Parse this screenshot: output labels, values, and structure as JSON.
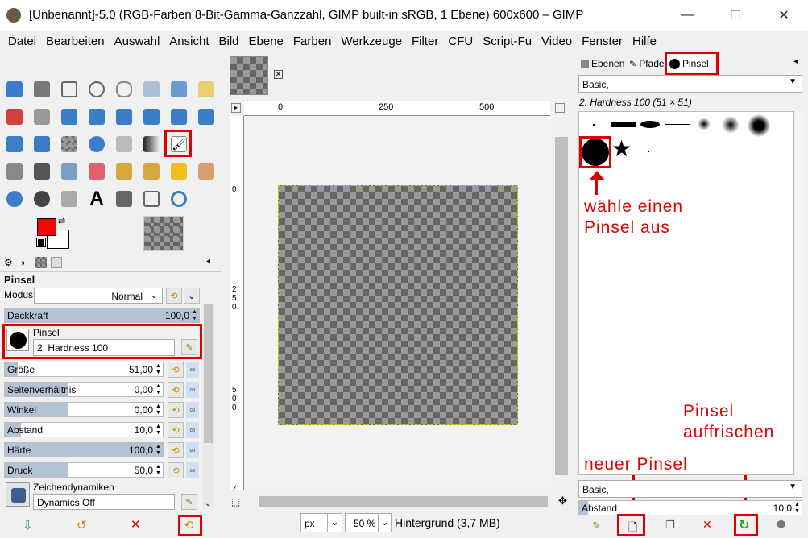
{
  "window": {
    "title": "[Unbenannt]-5.0 (RGB-Farben 8-Bit-Gamma-Ganzzahl, GIMP built-in sRGB, 1 Ebene) 600x600 – GIMP",
    "minimize": "—",
    "maximize": "☐",
    "close": "✕"
  },
  "menu": [
    "Datei",
    "Bearbeiten",
    "Auswahl",
    "Ansicht",
    "Bild",
    "Ebene",
    "Farben",
    "Werkzeuge",
    "Filter",
    "CFU",
    "Script-Fu",
    "Video",
    "Fenster",
    "Hilfe"
  ],
  "tool_options": {
    "title": "Pinsel",
    "mode_label": "Modus",
    "mode_value": "Normal",
    "opacity_label": "Deckkraft",
    "opacity_value": "100,0",
    "opacity": 1.0,
    "brush_label": "Pinsel",
    "brush_value": "2. Hardness 100",
    "rows": [
      {
        "label": "Größe",
        "value": "51,00",
        "fill": 0.08
      },
      {
        "label": "Seitenverhältnis",
        "value": "0,00",
        "fill": 0.4
      },
      {
        "label": "Winkel",
        "value": "0,00",
        "fill": 0.4
      },
      {
        "label": "Abstand",
        "value": "10,0",
        "fill": 0.1
      },
      {
        "label": "Härte",
        "value": "100,0",
        "fill": 1.0
      },
      {
        "label": "Druck",
        "value": "50,0",
        "fill": 0.4
      }
    ],
    "dynamics_label": "Zeichendynamiken",
    "dynamics_value": "Dynamics Off"
  },
  "colors": {
    "foreground": "#ff0000",
    "background": "#ffffff",
    "accent": "#e00000"
  },
  "canvas": {
    "hruler_labels": [
      "0",
      "250",
      "500"
    ],
    "vruler_labels": [
      "0",
      "2\n5\n0",
      "5\n0\n0",
      "7"
    ],
    "unit": "px",
    "zoom": "50 %",
    "status": "Hintergrund (3,7 MB)"
  },
  "right_panel": {
    "tabs": [
      "Ebenen",
      "Pfade",
      "Pinsel"
    ],
    "brush_set": "Basic,",
    "brush_name": "2. Hardness 100 (51 × 51)",
    "tag_value": "Basic,",
    "spacing_label": "Abstand",
    "spacing_value": "10,0"
  },
  "annotations": {
    "choose_brush": "wähle einen\nPinsel aus",
    "refresh": "Pinsel\nauffrischen",
    "new_brush": "neuer Pinsel"
  }
}
